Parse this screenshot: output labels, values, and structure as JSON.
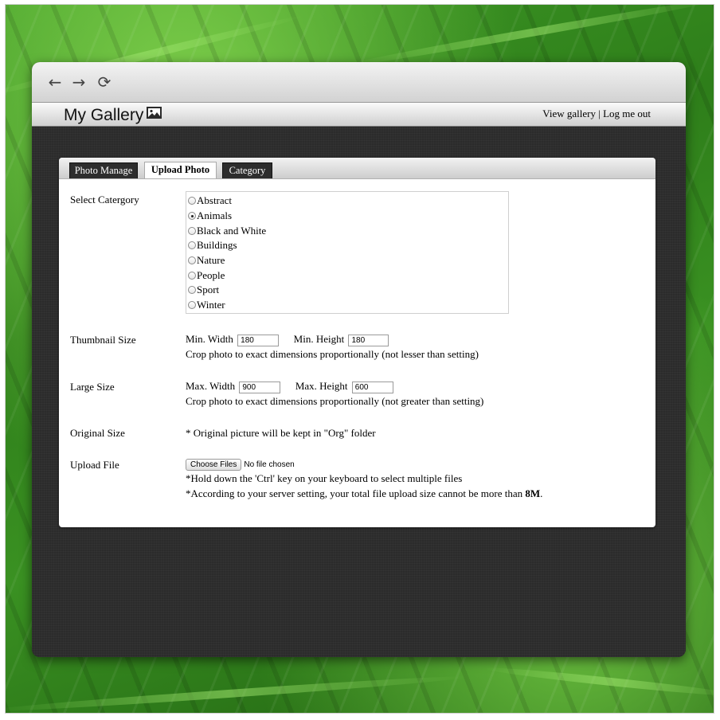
{
  "colors": {
    "window_bg": "#2a2a2a",
    "tab_dark_bg": "#2d2d2d",
    "panel_bg": "#ffffff"
  },
  "browser": {
    "icons": [
      "back-arrow-icon",
      "forward-arrow-icon",
      "reload-icon"
    ]
  },
  "header": {
    "title": "My Gallery",
    "title_icon": "picture-icon",
    "view_gallery": "View gallery",
    "separator": " | ",
    "logout": "Log me out"
  },
  "tabs": [
    {
      "label": "Photo Manage",
      "active": false
    },
    {
      "label": "Upload Photo",
      "active": true
    },
    {
      "label": "Category",
      "active": false
    }
  ],
  "form": {
    "category": {
      "label": "Select Catergory",
      "options": [
        "Abstract",
        "Animals",
        "Black and White",
        "Buildings",
        "Nature",
        "People",
        "Sport",
        "Winter"
      ],
      "selected": "Animals"
    },
    "thumbnail": {
      "label": "Thumbnail Size",
      "width_label": "Min. Width",
      "width_value": "180",
      "height_label": "Min. Height",
      "height_value": "180",
      "note": "Crop photo to exact dimensions proportionally (not lesser than setting)"
    },
    "large": {
      "label": "Large Size",
      "width_label": "Max. Width",
      "width_value": "900",
      "height_label": "Max. Height",
      "height_value": "600",
      "note": "Crop photo to exact dimensions proportionally (not greater than setting)"
    },
    "original": {
      "label": "Original Size",
      "note": "* Original picture will be kept in \"Org\" folder"
    },
    "upload": {
      "label": "Upload File",
      "button": "Choose Files",
      "status": "No file chosen",
      "note1": "*Hold down the 'Ctrl' key on your keyboard to select multiple files",
      "note2_prefix": "*According to your server setting, your total file upload size cannot be more than ",
      "note2_limit": "8M",
      "note2_suffix": "."
    }
  }
}
